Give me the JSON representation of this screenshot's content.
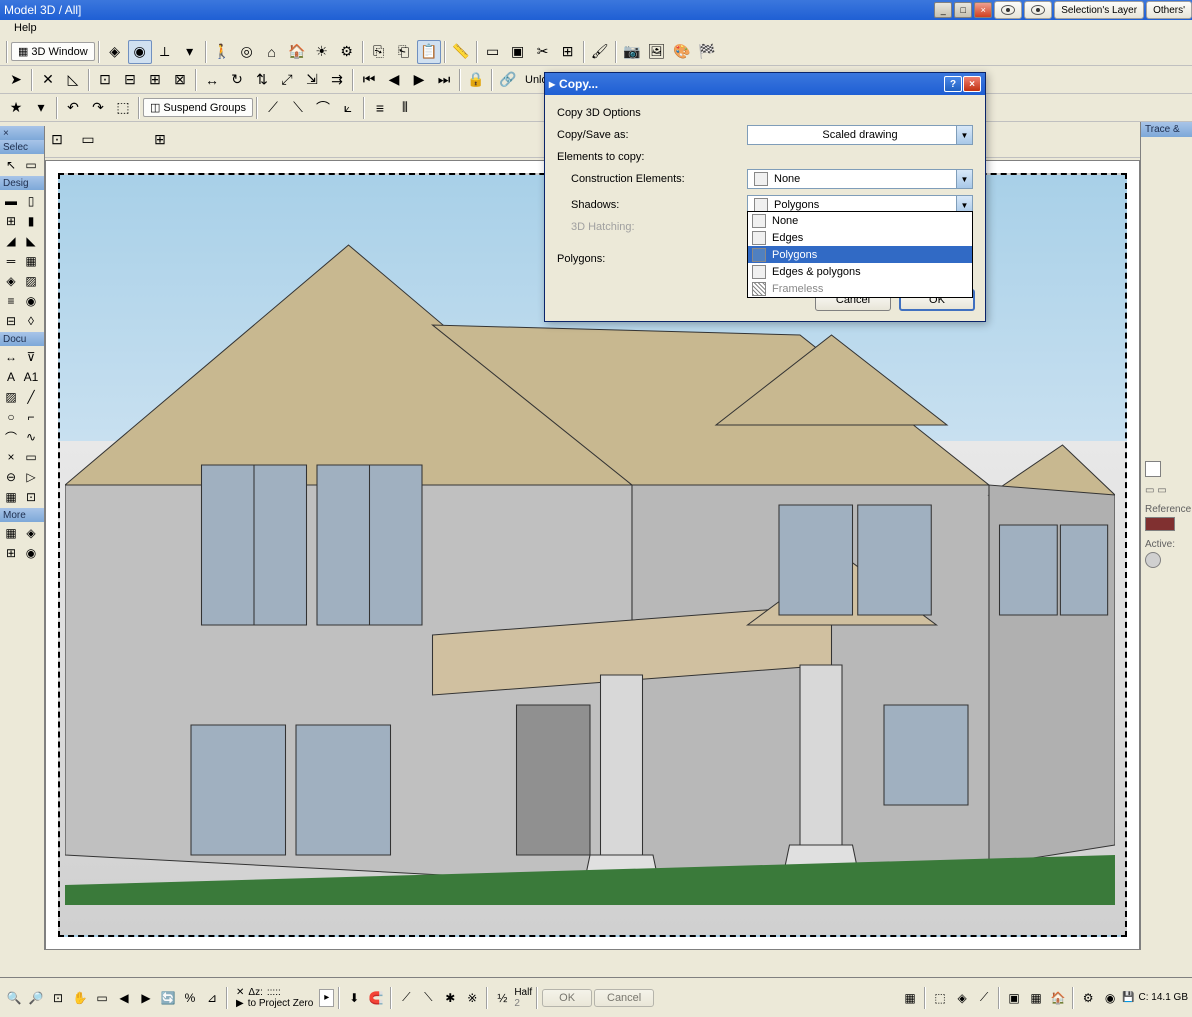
{
  "window": {
    "title": "Model 3D / All]",
    "min": "_",
    "max": "□",
    "close": "×",
    "selections_layer": "Selection's Layer",
    "others": "Others'"
  },
  "menu": {
    "help": "Help"
  },
  "tb3d": {
    "label": "3D Window"
  },
  "suspend": "Suspend Groups",
  "unlock": "Unlock A",
  "right_panel": {
    "trace": "Trace &",
    "reference": "Reference",
    "active": "Active:"
  },
  "toolbox": {
    "select": "Selec",
    "design": "Desig",
    "docu": "Docu",
    "more": "More"
  },
  "dialog": {
    "title": "Copy...",
    "subtitle": "Copy 3D Options",
    "copy_save_as": "Copy/Save as:",
    "copy_save_value": "Scaled drawing",
    "elements_to_copy": "Elements to copy:",
    "construction_elements": "Construction Elements:",
    "construction_value": "None",
    "shadows": "Shadows:",
    "shadows_value": "Polygons",
    "hatching": "3D Hatching:",
    "polygons": "Polygons:",
    "dropdown": {
      "none": "None",
      "edges": "Edges",
      "polygons": "Polygons",
      "edges_polygons": "Edges & polygons",
      "frameless": "Frameless"
    },
    "cancel": "Cancel",
    "ok": "OK"
  },
  "status": {
    "dz": "Δz:",
    "dz_value": ":::::",
    "project_zero": "to Project Zero",
    "half": "Half",
    "half_sub": "2",
    "ok": "OK",
    "cancel": "Cancel",
    "disk": "C: 14.1 GB"
  }
}
